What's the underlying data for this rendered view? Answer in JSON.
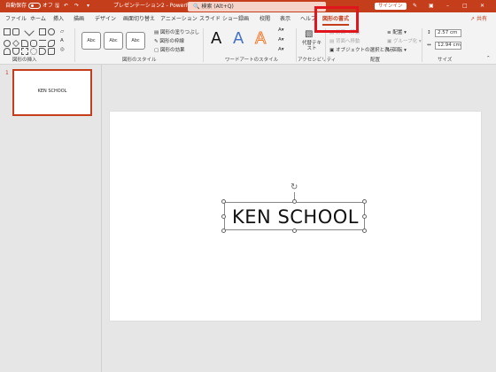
{
  "titlebar": {
    "autosave": "自動保存",
    "toggle": "オフ",
    "doc_title": "プレゼンテーション2 - PowerPoint",
    "search_placeholder": "検索 (Alt+Q)",
    "signin": "サインイン"
  },
  "tabs": [
    "ファイル",
    "ホーム",
    "挿入",
    "描画",
    "デザイン",
    "画面切り替え",
    "アニメーション",
    "スライド ショー",
    "録画",
    "校閲",
    "表示",
    "ヘルプ",
    "図形の書式"
  ],
  "active_tab": "図形の書式",
  "share": "共有",
  "ribbon": {
    "groups": {
      "insert_shapes": "図形の挿入",
      "shape_styles": "図形のスタイル",
      "wordart_styles": "ワードアートのスタイル",
      "accessibility": "アクセシビリティ",
      "arrange": "配置",
      "size": "サイズ"
    },
    "style_presets": [
      "Abc",
      "Abc",
      "Abc"
    ],
    "shape_fill": "図形の塗りつぶし",
    "shape_outline": "図形の枠線",
    "shape_effects": "図形の効果",
    "alt_text": "代替テキスト",
    "bring_forward": "前面へ移動",
    "send_backward": "背面へ移動",
    "selection_pane": "オブジェクトの選択と表示",
    "align": "配置",
    "group": "グループ化",
    "rotate": "回転",
    "height": "2.57 cm",
    "width": "12.94 cm"
  },
  "slides_panel": {
    "slide_number": "1",
    "thumb_text": "KEN SCHOOL"
  },
  "slide": {
    "textbox_text": "KEN SCHOOL"
  },
  "colors": {
    "accent": "#c43e1c",
    "highlight_box": "#e0151d"
  }
}
